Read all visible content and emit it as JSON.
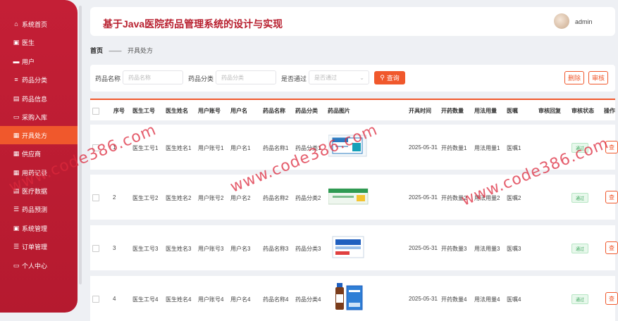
{
  "header": {
    "title": "基于Java医院药品管理系统的设计与实现",
    "username": "admin"
  },
  "sidebar": {
    "items": [
      {
        "icon": "⌂",
        "icon_name": "home-icon",
        "label": "系统首页",
        "active": false
      },
      {
        "icon": "▣",
        "icon_name": "doctor-icon",
        "label": "医生",
        "active": false
      },
      {
        "icon": "▬",
        "icon_name": "user-icon",
        "label": "用户",
        "active": false
      },
      {
        "icon": "≡",
        "icon_name": "category-icon",
        "label": "药品分类",
        "active": false
      },
      {
        "icon": "▤",
        "icon_name": "drug-info-icon",
        "label": "药品信息",
        "active": false
      },
      {
        "icon": "▭",
        "icon_name": "purchase-icon",
        "label": "采购入库",
        "active": false
      },
      {
        "icon": "▦",
        "icon_name": "prescription-icon",
        "label": "开具处方",
        "active": true
      },
      {
        "icon": "▦",
        "icon_name": "supplier-icon",
        "label": "供应商",
        "active": false
      },
      {
        "icon": "▦",
        "icon_name": "usage-record-icon",
        "label": "用药记录",
        "active": false
      },
      {
        "icon": "▤",
        "icon_name": "medical-data-icon",
        "label": "医疗数据",
        "active": false
      },
      {
        "icon": "☰",
        "icon_name": "forecast-icon",
        "label": "药品预测",
        "active": false
      },
      {
        "icon": "▣",
        "icon_name": "system-icon",
        "label": "系统管理",
        "active": false
      },
      {
        "icon": "☰",
        "icon_name": "order-icon",
        "label": "订单管理",
        "active": false
      },
      {
        "icon": "▭",
        "icon_name": "profile-icon",
        "label": "个人中心",
        "active": false
      }
    ]
  },
  "breadcrumb": {
    "home": "首页",
    "separator": "——",
    "current": "开具处方"
  },
  "filters": {
    "name_label": "药品名称",
    "name_placeholder": "药品名称",
    "category_label": "药品分类",
    "category_placeholder": "药品分类",
    "pass_label": "是否通过",
    "pass_placeholder": "是否通过",
    "search_label": "查询",
    "delete_label": "删除",
    "review_label": "审核"
  },
  "table": {
    "columns": [
      "序号",
      "医生工号",
      "医生姓名",
      "用户账号",
      "用户名",
      "药品名称",
      "药品分类",
      "药品图片",
      "开具时间",
      "开药数量",
      "用法用量",
      "医嘱",
      "审核回复",
      "审核状态",
      "操作"
    ],
    "rows": [
      {
        "index": "1",
        "doctor_id": "医生工号1",
        "doctor_name": "医生姓名1",
        "account": "用户账号1",
        "username": "用户名1",
        "drug_name": "药品名称1",
        "drug_category": "药品分类1",
        "time": "2025-05-31",
        "quantity": "开药数量1",
        "dosage": "用法用量1",
        "advice": "医嘱1",
        "reply": "",
        "status": "通过",
        "action": "查"
      },
      {
        "index": "2",
        "doctor_id": "医生工号2",
        "doctor_name": "医生姓名2",
        "account": "用户账号2",
        "username": "用户名2",
        "drug_name": "药品名称2",
        "drug_category": "药品分类2",
        "time": "2025-05-31",
        "quantity": "开药数量2",
        "dosage": "用法用量2",
        "advice": "医嘱2",
        "reply": "",
        "status": "通过",
        "action": "查"
      },
      {
        "index": "3",
        "doctor_id": "医生工号3",
        "doctor_name": "医生姓名3",
        "account": "用户账号3",
        "username": "用户名3",
        "drug_name": "药品名称3",
        "drug_category": "药品分类3",
        "time": "2025-05-31",
        "quantity": "开药数量3",
        "dosage": "用法用量3",
        "advice": "医嘱3",
        "reply": "",
        "status": "通过",
        "action": "查"
      },
      {
        "index": "4",
        "doctor_id": "医生工号4",
        "doctor_name": "医生姓名4",
        "account": "用户账号4",
        "username": "用户名4",
        "drug_name": "药品名称4",
        "drug_category": "药品分类4",
        "time": "2025-05-31",
        "quantity": "开药数量4",
        "dosage": "用法用量4",
        "advice": "医嘱4",
        "reply": "",
        "status": "通过",
        "action": "查"
      }
    ]
  },
  "watermark": "www.code386.com",
  "colors": {
    "sidebar": "#c41f36",
    "accent": "#f0582c",
    "title": "#b8202f",
    "pass": "#3aa55a"
  }
}
